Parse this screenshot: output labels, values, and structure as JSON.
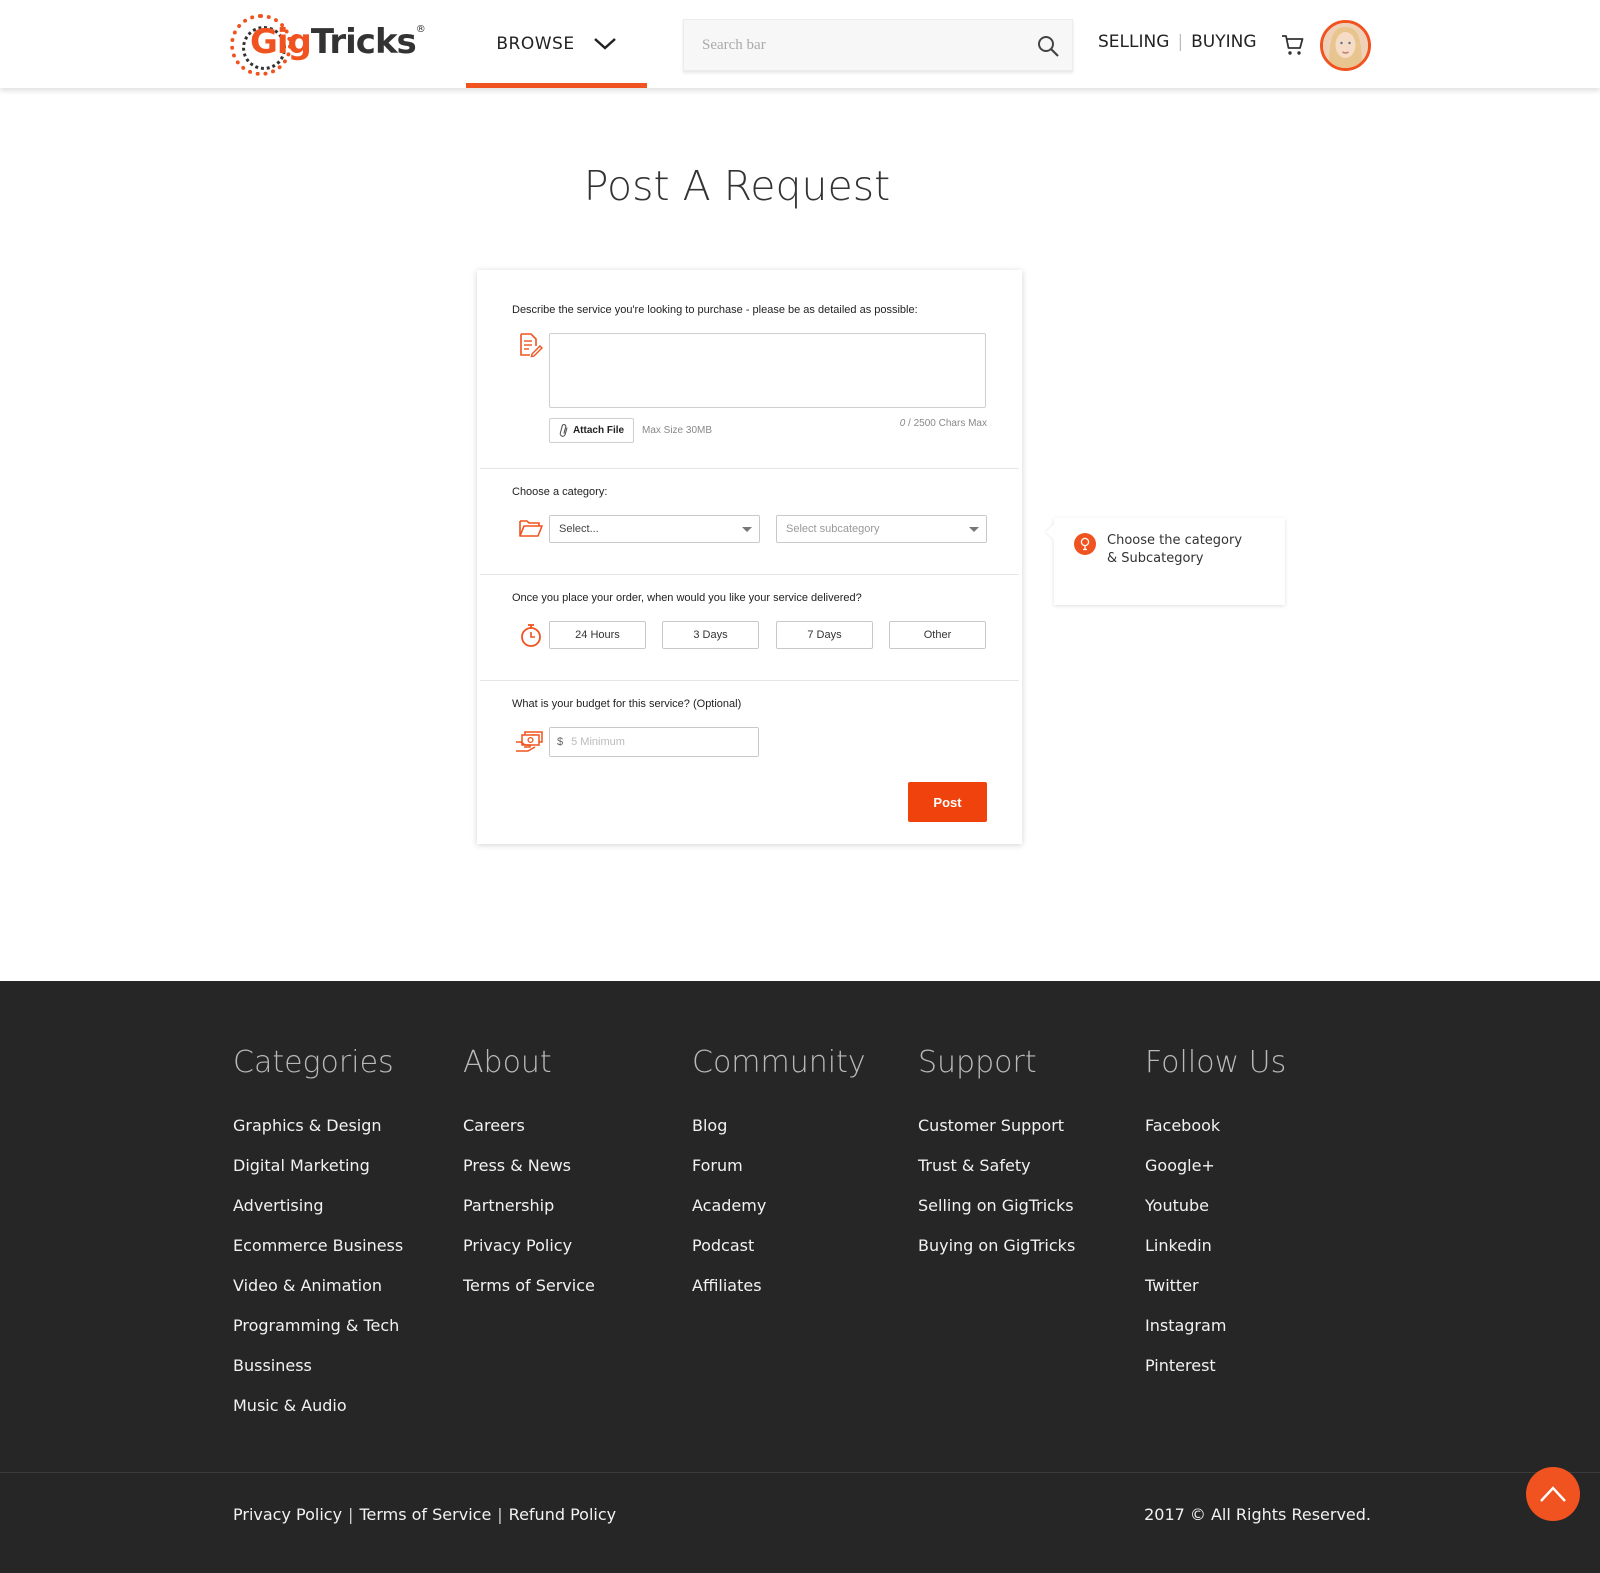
{
  "header": {
    "logo": {
      "gig": "Gig",
      "tricks": "Tricks",
      "reg": "®"
    },
    "browse_label": "BROWSE",
    "search_placeholder": "Search bar",
    "selling_label": "SELLING",
    "separator": "|",
    "buying_label": "BUYING",
    "accent_color": "#f0531f"
  },
  "main": {
    "title": "Post A Request",
    "describe": {
      "label": "Describe the service you're looking to purchase - please be as detailed as possible:",
      "value": "",
      "attach_label": "Attach File",
      "max_size": "Max Size 30MB",
      "char_count": "0",
      "char_max": " / 2500 Chars Max"
    },
    "category": {
      "label": "Choose a category:",
      "category_value": "Select...",
      "subcategory_value": "Select subcategory"
    },
    "delivery": {
      "label": "Once you place your order, when would you like your service delivered?",
      "options": [
        "24 Hours",
        "3 Days",
        "7 Days",
        "Other"
      ]
    },
    "budget": {
      "label": "What is your budget for this service? (Optional)",
      "currency": "$",
      "placeholder": "5 Minimum"
    },
    "post_label": "Post",
    "tip": {
      "line1": "Choose the category",
      "line2": "& Subcategory"
    }
  },
  "footer": {
    "columns": [
      {
        "title": "Categories",
        "items": [
          "Graphics & Design",
          "Digital Marketing",
          "Advertising",
          "Ecommerce Business",
          "Video & Animation",
          "Programming & Tech",
          "Bussiness",
          "Music & Audio"
        ]
      },
      {
        "title": "About",
        "items": [
          "Careers",
          "Press & News",
          "Partnership",
          "Privacy Policy",
          "Terms of Service"
        ]
      },
      {
        "title": "Community",
        "items": [
          "Blog",
          "Forum",
          "Academy",
          "Podcast",
          "Affiliates"
        ]
      },
      {
        "title": "Support",
        "items": [
          "Customer Support",
          "Trust & Safety",
          "Selling on GigTricks",
          "Buying on GigTricks"
        ]
      },
      {
        "title": "Follow Us",
        "items": [
          "Facebook",
          "Google+",
          "Youtube",
          "Linkedin",
          "Twitter",
          "Instagram",
          "Pinterest"
        ]
      }
    ],
    "bottom": {
      "privacy": "Privacy Policy",
      "terms": "Terms of Service",
      "refund": "Refund Policy",
      "separator": "|",
      "copyright": "2017 © All Rights Reserved."
    },
    "background_color": "#262626"
  }
}
